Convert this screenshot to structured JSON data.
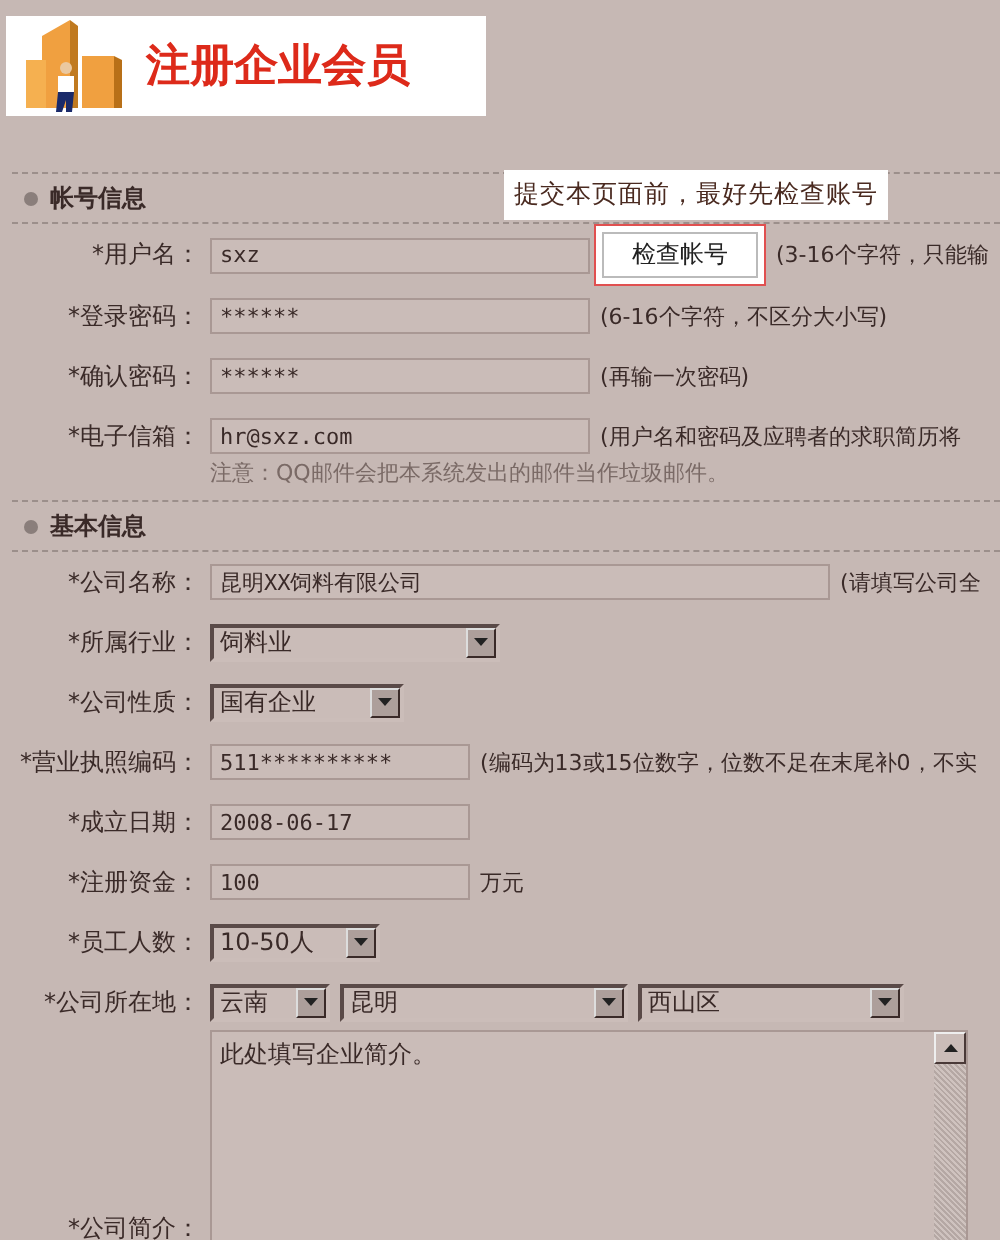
{
  "logo": {
    "title": "注册企业会员"
  },
  "sections": [
    {
      "title": "帐号信息",
      "tooltip": "提交本页面前，最好先检查账号",
      "fields": [
        {
          "kind": "text",
          "label": "*用户名：",
          "value": "sxz",
          "button": "检查帐号",
          "hint": "(3-16个字符，只能输"
        },
        {
          "kind": "text",
          "label": "*登录密码：",
          "value": "******",
          "hint": "(6-16个字符，不区分大小写)"
        },
        {
          "kind": "text",
          "label": "*确认密码：",
          "value": "******",
          "hint": "(再输一次密码)"
        },
        {
          "kind": "text",
          "label": "*电子信箱：",
          "value": "hr@sxz.com",
          "hint": "(用户名和密码及应聘者的求职简历将",
          "note": "注意：QQ邮件会把本系统发出的邮件当作垃圾邮件。"
        }
      ]
    },
    {
      "title": "基本信息",
      "fields": [
        {
          "kind": "text",
          "label": "*公司名称：",
          "value": "昆明XX饲料有限公司",
          "hint": "(请填写公司全"
        },
        {
          "kind": "select",
          "label": "*所属行业：",
          "value": "饲料业"
        },
        {
          "kind": "select",
          "label": "*公司性质：",
          "value": "国有企业"
        },
        {
          "kind": "text",
          "label": "*营业执照编码：",
          "value": "511**********",
          "hint": "(编码为13或15位数字，位数不足在末尾补0，不实"
        },
        {
          "kind": "text",
          "label": "*成立日期：",
          "value": "2008-06-17"
        },
        {
          "kind": "text",
          "label": "*注册资金：",
          "value": "100",
          "hint": "万元"
        },
        {
          "kind": "select",
          "label": "*员工人数：",
          "value": "10-50人"
        },
        {
          "kind": "selects",
          "label": "*公司所在地：",
          "values": [
            "云南",
            "昆明",
            "西山区"
          ]
        },
        {
          "kind": "textarea",
          "label": "*公司简介：",
          "value": "此处填写企业简介。"
        }
      ]
    }
  ]
}
